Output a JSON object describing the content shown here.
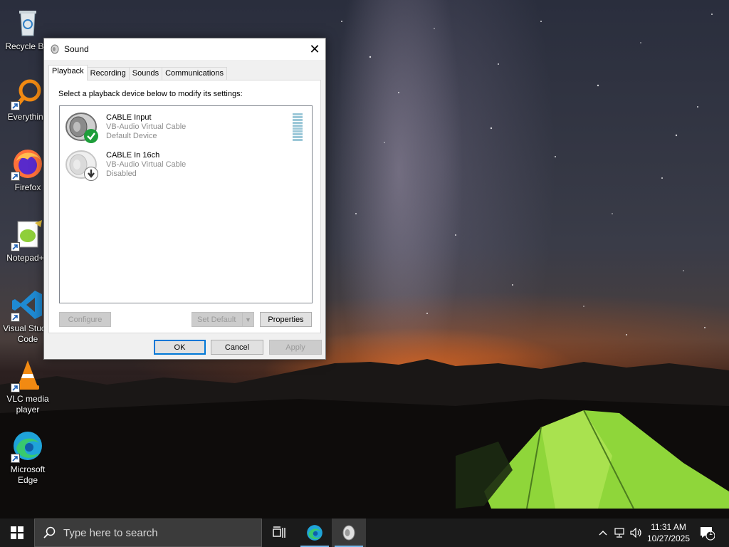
{
  "desktop": {
    "icons": [
      {
        "label": "Recycle Bin",
        "icon": "recycle-bin-icon"
      },
      {
        "label": "Everything",
        "icon": "everything-search-icon"
      },
      {
        "label": "Firefox",
        "icon": "firefox-icon"
      },
      {
        "label": "Notepad++",
        "icon": "notepad-plus-plus-icon"
      },
      {
        "label": "Visual Studio Code",
        "icon": "vscode-icon"
      },
      {
        "label": "VLC media player",
        "icon": "vlc-icon"
      },
      {
        "label": "Microsoft Edge",
        "icon": "edge-icon"
      }
    ]
  },
  "dialog": {
    "title": "Sound",
    "close_glyph": "✕",
    "tabs": [
      {
        "label": "Playback",
        "active": true
      },
      {
        "label": "Recording",
        "active": false
      },
      {
        "label": "Sounds",
        "active": false
      },
      {
        "label": "Communications",
        "active": false
      }
    ],
    "instruction": "Select a playback device below to modify its settings:",
    "devices": [
      {
        "name": "CABLE Input",
        "driver": "VB-Audio Virtual Cable",
        "status": "Default Device",
        "badge": "check-badge-icon",
        "badge_color": "#1e9e3a",
        "selected": true
      },
      {
        "name": "CABLE In 16ch",
        "driver": "VB-Audio Virtual Cable",
        "status": "Disabled",
        "badge": "down-arrow-badge-icon",
        "badge_color": "#333333",
        "selected": false
      }
    ],
    "buttons": {
      "configure": "Configure",
      "set_default": "Set Default",
      "set_default_arrow": "▼",
      "properties": "Properties",
      "ok": "OK",
      "cancel": "Cancel",
      "apply": "Apply"
    }
  },
  "taskbar": {
    "search_placeholder": "Type here to search",
    "apps": [
      {
        "name": "task-view",
        "icon": "task-view-icon"
      },
      {
        "name": "edge",
        "icon": "edge-icon",
        "running": true
      },
      {
        "name": "sound",
        "icon": "speaker-app-icon",
        "running": true,
        "active": true
      }
    ],
    "tray": {
      "chevron": "^",
      "notification_count": "1"
    },
    "clock": {
      "time": "11:31 AM",
      "date": "10/27/2025"
    }
  },
  "colors": {
    "accent": "#0078d7",
    "taskbar_bg": "#1b1b1b",
    "dialog_bg": "#f0f0f0",
    "check_green": "#1e9e3a",
    "tent_green": "#8fd63a"
  }
}
